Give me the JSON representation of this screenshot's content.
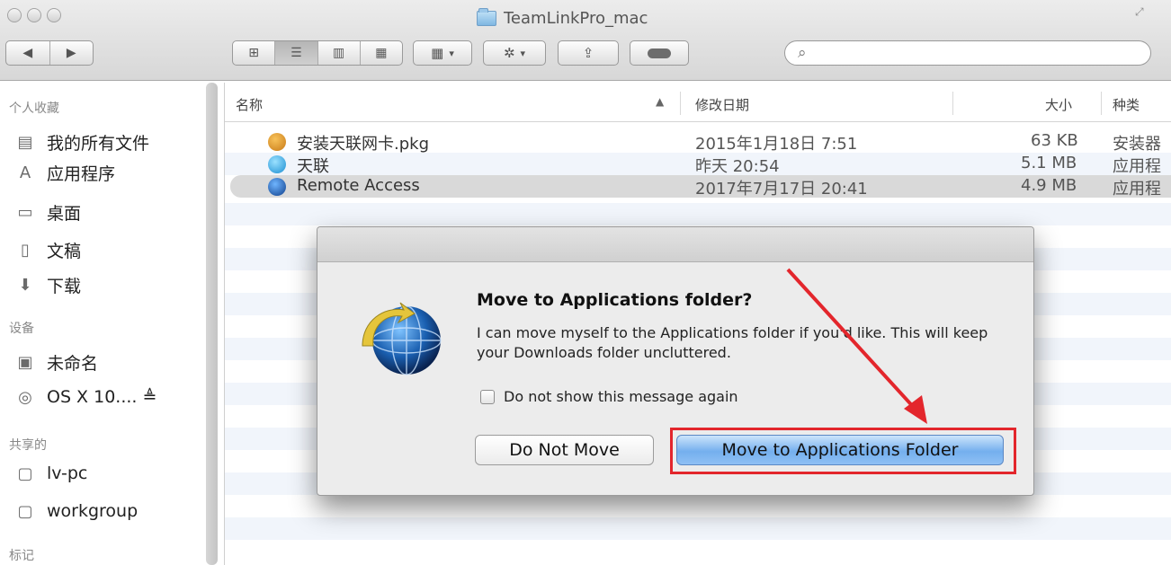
{
  "window": {
    "title": "TeamLinkPro_mac",
    "search_placeholder": ""
  },
  "sidebar": {
    "sections": [
      {
        "label": "个人收藏"
      },
      {
        "label": "设备"
      },
      {
        "label": "共享的"
      },
      {
        "label": "标记"
      }
    ],
    "favorites": [
      "我的所有文件",
      "应用程序",
      "桌面",
      "文稿",
      "下载"
    ],
    "devices": [
      "未命名",
      "OS X 10.... ≜"
    ],
    "shared": [
      "lv-pc",
      "workgroup"
    ]
  },
  "columns": {
    "name": "名称",
    "date": "修改日期",
    "size": "大小",
    "kind": "种类"
  },
  "files": [
    {
      "name": "安装天联网卡.pkg",
      "date": "2015年1月18日 7:51",
      "size": "63 KB",
      "kind": "安装器"
    },
    {
      "name": "天联",
      "date": "昨天 20:54",
      "size": "5.1 MB",
      "kind": "应用程"
    },
    {
      "name": "Remote Access",
      "date": "2017年7月17日 20:41",
      "size": "4.9 MB",
      "kind": "应用程"
    }
  ],
  "dialog": {
    "title": "Move to Applications folder?",
    "message": "I can move myself to the Applications folder if you'd like. This will keep your Downloads folder uncluttered.",
    "checkbox_label": "Do not show this message again",
    "checkbox_checked": false,
    "cancel_label": "Do Not Move",
    "confirm_label": "Move to Applications Folder"
  },
  "colors": {
    "annotation": "#e3262c",
    "primary_button": "#74afee",
    "selected_row": "#d9d9d9"
  }
}
